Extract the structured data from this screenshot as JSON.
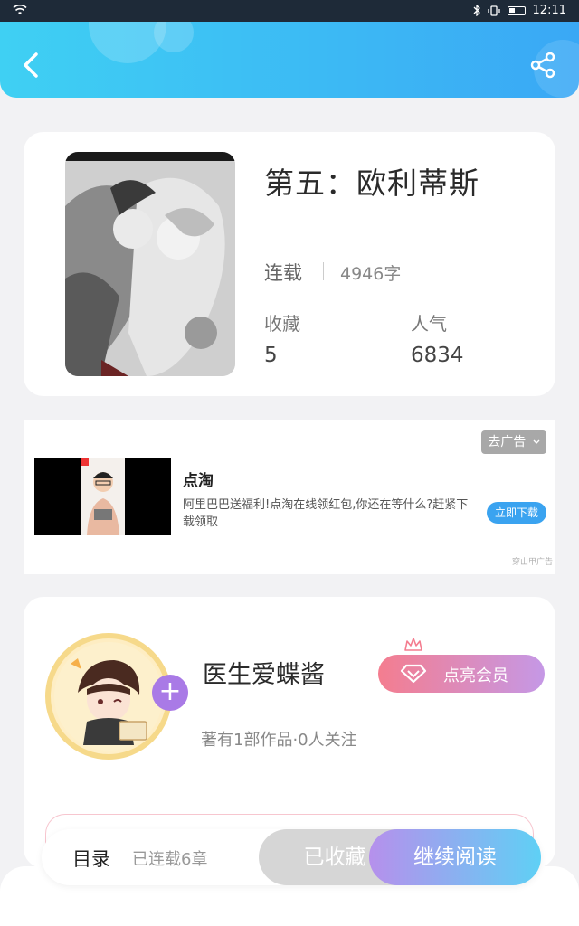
{
  "status_bar": {
    "time": "12:11",
    "icons": [
      "wifi-icon",
      "bluetooth-icon",
      "vibrate-icon",
      "battery-icon"
    ]
  },
  "header": {
    "back_icon": "chevron-left-icon",
    "share_icon": "share-icon",
    "gradient": [
      "#3fd0f3",
      "#3aa8f5"
    ]
  },
  "book": {
    "title": "第五：欧利蒂斯",
    "status": "连载",
    "word_count": "4946字",
    "favorites_label": "收藏",
    "favorites_value": "5",
    "popularity_label": "人气",
    "popularity_value": "6834"
  },
  "ad": {
    "remove_label": "去广告",
    "name": "点淘",
    "description": "阿里巴巴送福利!点淘在线领红包,你还在等什么?赶紧下载领取",
    "download_label": "立即下载",
    "source": "穿山甲广告"
  },
  "author": {
    "name": "医生爱蝶酱",
    "stats": "著有1部作品·0人关注",
    "vip_label": "点亮会员",
    "follow_icon": "plus-icon"
  },
  "bottom_bar": {
    "toc_label": "目录",
    "chapter_count": "已连载6章",
    "collected_label": "已收藏",
    "read_label": "继续阅读"
  },
  "colors": {
    "accent_blue": "#3aa8f5",
    "vip_pink": "#f47d8f",
    "read_purple": "#b690ec",
    "read_cyan": "#5fd0f5"
  }
}
